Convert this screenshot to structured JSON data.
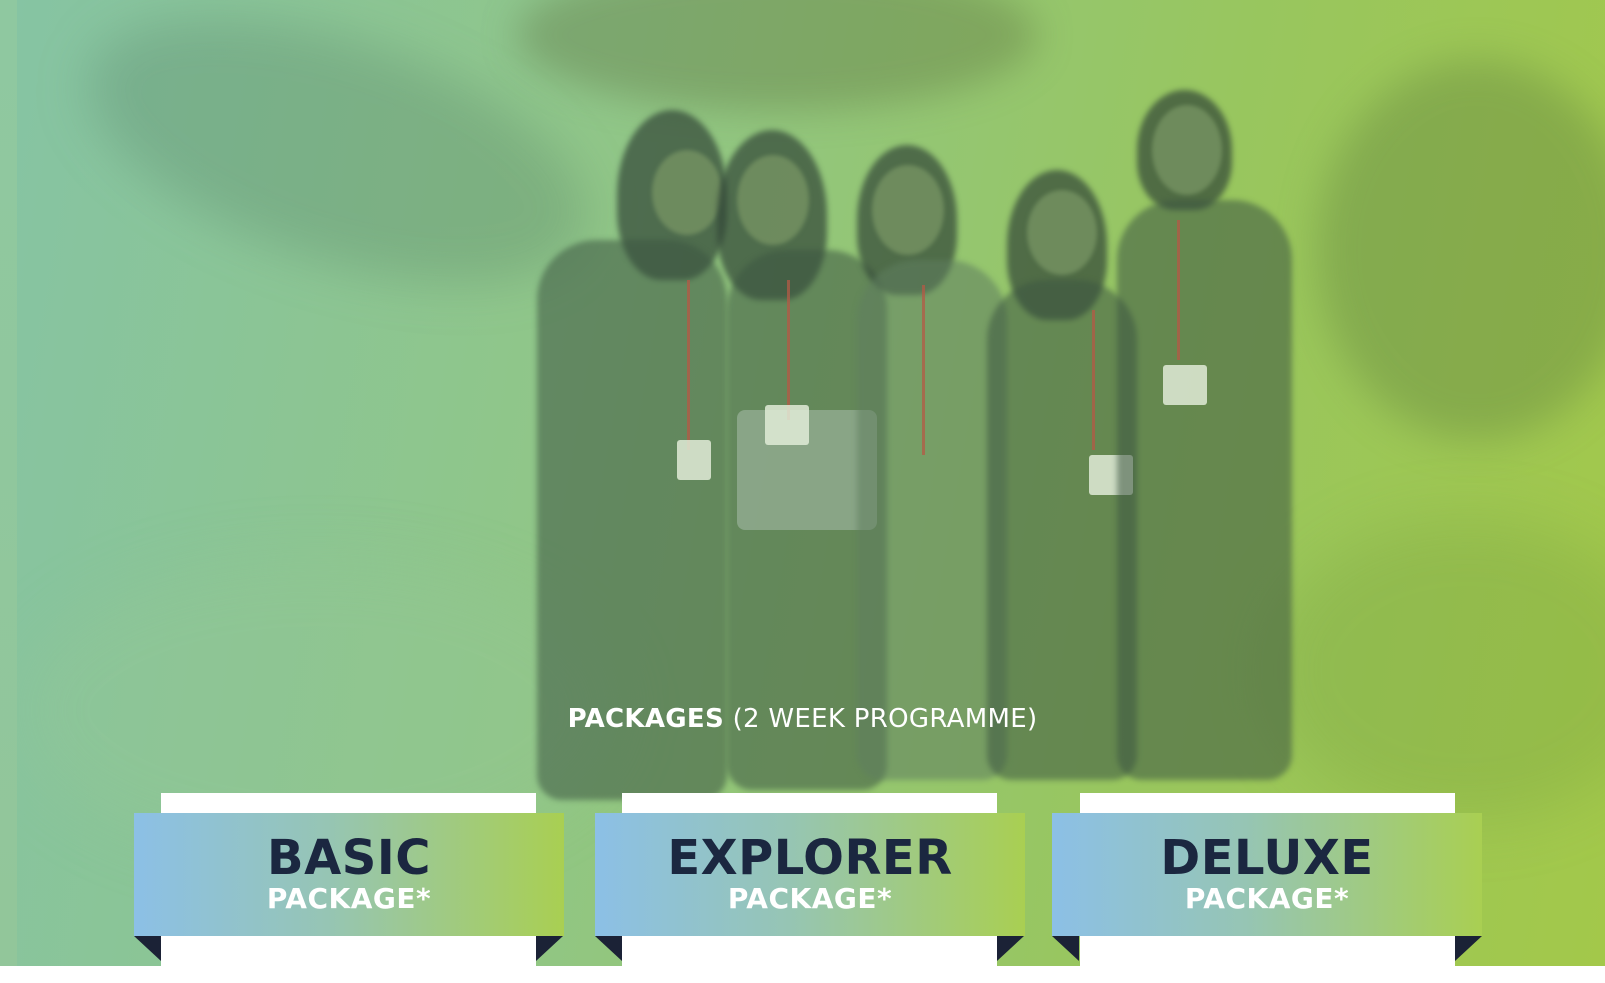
{
  "heading": {
    "bold": "PACKAGES",
    "light": "(2 WEEK PROGRAMME)"
  },
  "packages": [
    {
      "title": "BASIC",
      "subtitle": "PACKAGE*"
    },
    {
      "title": "EXPLORER",
      "subtitle": "PACKAGE*"
    },
    {
      "title": "DELUXE",
      "subtitle": "PACKAGE*"
    }
  ],
  "colors": {
    "overlay_start": "#86c4a3",
    "overlay_end": "#a3c84a",
    "ribbon_start": "#8cc0e6",
    "ribbon_end": "#a9cf52",
    "title_text": "#1b2740",
    "subtitle_text": "#ffffff",
    "fold": "#1b2236"
  }
}
